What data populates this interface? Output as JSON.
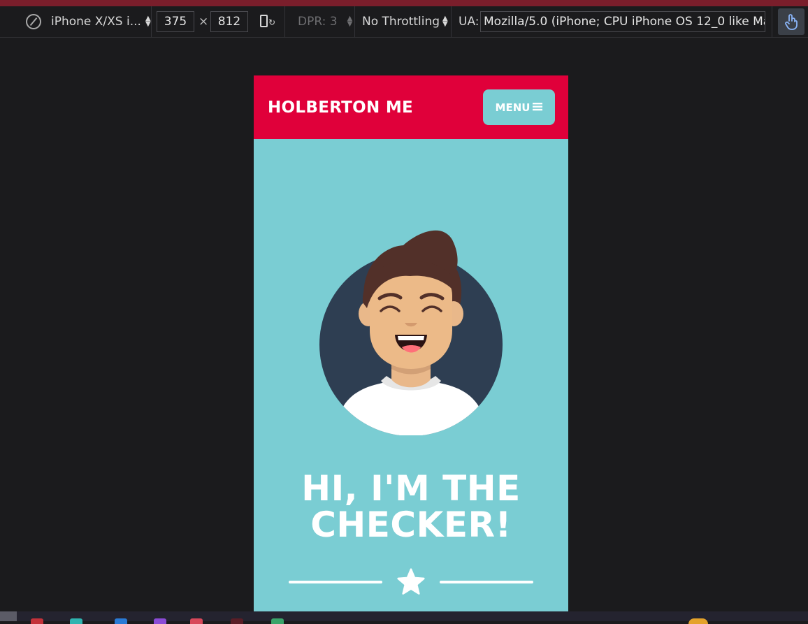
{
  "devtools": {
    "device_name": "iPhone X/XS i...",
    "width": "375",
    "times": "×",
    "height": "812",
    "dpr": "DPR: 3",
    "throttling": "No Throttling",
    "ua_label": "UA:",
    "ua_value": "Mozilla/5.0 (iPhone; CPU iPhone OS 12_0 like Mac"
  },
  "page": {
    "brand": "HOLBERTON ME",
    "menu_label": "MENU",
    "hero_title_line1": "HI, I'M THE",
    "hero_title_line2": "CHECKER!"
  },
  "colors": {
    "header": "#e0003a",
    "accent": "#7acdd3",
    "avatar_bg": "#2e3e52"
  },
  "icons": [
    "compass-icon",
    "rotate-icon",
    "touch-icon",
    "hamburger-icon",
    "star-icon"
  ]
}
